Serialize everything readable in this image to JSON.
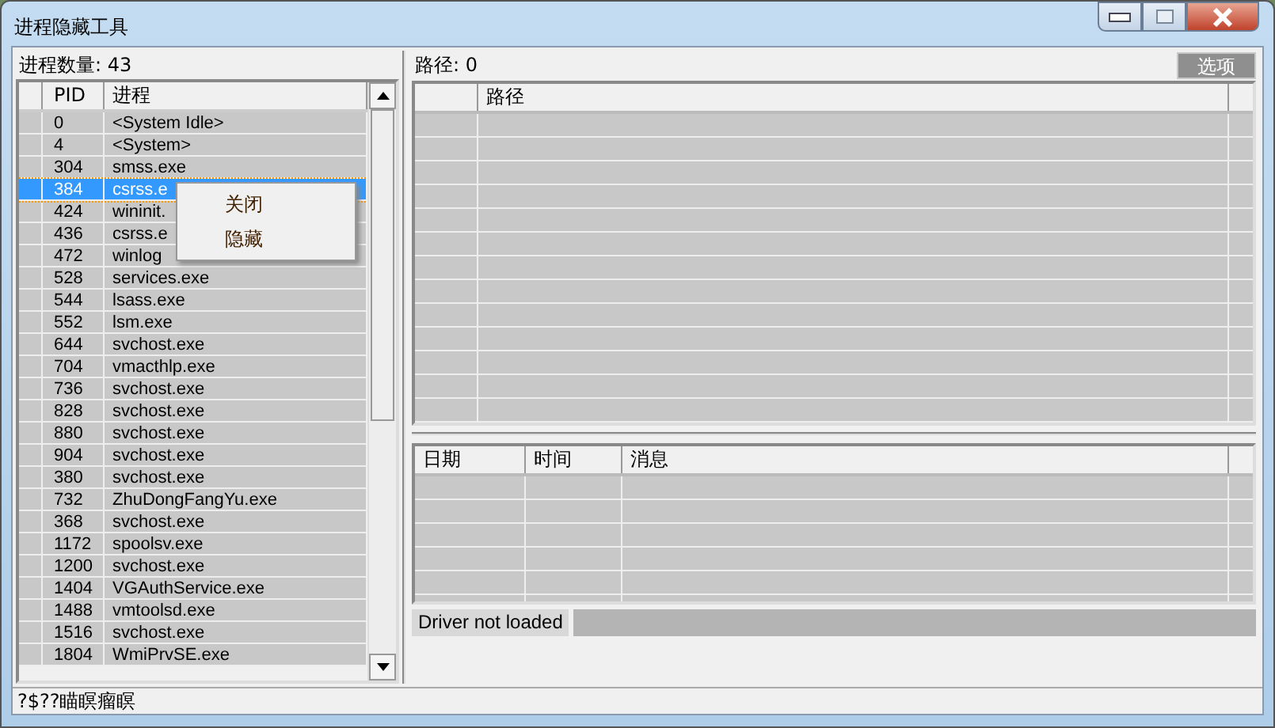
{
  "window": {
    "title": "进程隐藏工具"
  },
  "process_panel": {
    "label": "进程数量: 43",
    "columns": [
      "PID",
      "进程"
    ],
    "rows": [
      {
        "pid": "0",
        "name": "<System Idle>",
        "selected": false
      },
      {
        "pid": "4",
        "name": "<System>",
        "selected": false
      },
      {
        "pid": "304",
        "name": "smss.exe",
        "selected": false
      },
      {
        "pid": "384",
        "name": "csrss.e",
        "selected": true
      },
      {
        "pid": "424",
        "name": "wininit.",
        "selected": false
      },
      {
        "pid": "436",
        "name": "csrss.e",
        "selected": false
      },
      {
        "pid": "472",
        "name": "winlog",
        "selected": false
      },
      {
        "pid": "528",
        "name": "services.exe",
        "selected": false
      },
      {
        "pid": "544",
        "name": "lsass.exe",
        "selected": false
      },
      {
        "pid": "552",
        "name": "lsm.exe",
        "selected": false
      },
      {
        "pid": "644",
        "name": "svchost.exe",
        "selected": false
      },
      {
        "pid": "704",
        "name": "vmacthlp.exe",
        "selected": false
      },
      {
        "pid": "736",
        "name": "svchost.exe",
        "selected": false
      },
      {
        "pid": "828",
        "name": "svchost.exe",
        "selected": false
      },
      {
        "pid": "880",
        "name": "svchost.exe",
        "selected": false
      },
      {
        "pid": "904",
        "name": "svchost.exe",
        "selected": false
      },
      {
        "pid": "380",
        "name": "svchost.exe",
        "selected": false
      },
      {
        "pid": "732",
        "name": "ZhuDongFangYu.exe",
        "selected": false
      },
      {
        "pid": "368",
        "name": "svchost.exe",
        "selected": false
      },
      {
        "pid": "1172",
        "name": "spoolsv.exe",
        "selected": false
      },
      {
        "pid": "1200",
        "name": "svchost.exe",
        "selected": false
      },
      {
        "pid": "1404",
        "name": "VGAuthService.exe",
        "selected": false
      },
      {
        "pid": "1488",
        "name": "vmtoolsd.exe",
        "selected": false
      },
      {
        "pid": "1516",
        "name": "svchost.exe",
        "selected": false
      },
      {
        "pid": "1804",
        "name": "WmiPrvSE.exe",
        "selected": false
      }
    ]
  },
  "context_menu": {
    "items": [
      "关闭",
      "隐藏"
    ]
  },
  "path_panel": {
    "label": "路径: 0",
    "button": {
      "label": "选项",
      "disabled": true
    },
    "columns": [
      "路径"
    ]
  },
  "log_table": {
    "columns": [
      "日期",
      "时间",
      "消息"
    ]
  },
  "driver_status": "Driver not loaded",
  "status_bar": "?$??瞄瞑瘤瞑"
}
